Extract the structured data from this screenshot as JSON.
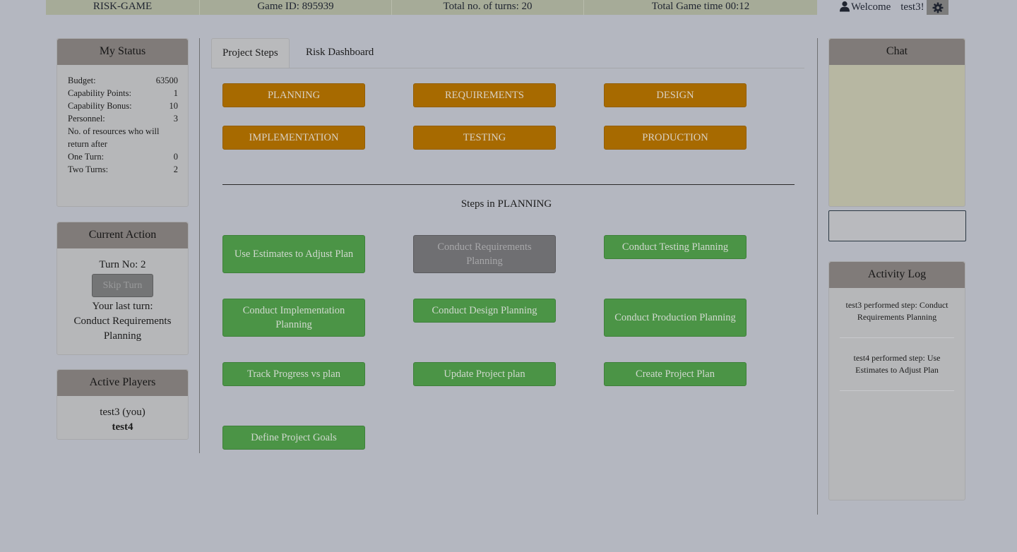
{
  "topbar": {
    "app_title": "RISK-GAME",
    "game_id": "Game  ID: 895939",
    "total_turns": "Total  no. of turns:  20",
    "total_time": "Total  Game  time  00:12"
  },
  "user": {
    "welcome": "Welcome",
    "username": "test3!"
  },
  "my_status": {
    "title": "My Status",
    "rows": [
      {
        "label": "Budget:",
        "value": "63500"
      },
      {
        "label": "Capability  Points:",
        "value": "1"
      },
      {
        "label": "Capability  Bonus:",
        "value": "10"
      },
      {
        "label": "Personnel:",
        "value": "3"
      }
    ],
    "resources_note": "No. of resources  who  will return  after",
    "return_rows": [
      {
        "label": "One Turn:",
        "value": "0"
      },
      {
        "label": "Two Turns:",
        "value": "2"
      }
    ]
  },
  "current_action": {
    "title": "Current  Action",
    "turn_no": "Turn  No: 2",
    "skip_label": "Skip Turn",
    "last_turn_label": "Your  last turn:",
    "last_turn_value": "Conduct  Requirements Planning"
  },
  "active_players": {
    "title": "Active Players",
    "players": [
      "test3  (you)",
      "test4"
    ]
  },
  "tabs": {
    "project_steps": "Project Steps",
    "risk_dashboard": "Risk Dashboard"
  },
  "phases": [
    "PLANNING",
    "REQUIREMENTS",
    "DESIGN",
    "IMPLEMENTATION",
    "TESTING",
    "PRODUCTION"
  ],
  "steps_title": "Steps  in  PLANNING",
  "steps": [
    "Use Estimates  to Adjust Plan",
    "Conduct  Requirements Planning",
    "Conduct  Testing  Planning",
    "Conduct  Implementation Planning",
    "Conduct  Design  Planning",
    "Conduct  Production Planning",
    "Track Progress  vs plan",
    "Update  Project  plan",
    "Create  Project  Plan",
    "Define  Project  Goals"
  ],
  "chat": {
    "title": "Chat",
    "input_value": ""
  },
  "activity_log": {
    "title": "Activity  Log",
    "entries": [
      "test3  performed   step:  Conduct Requirements   Planning",
      "test4  performed   step:  Use Estimates  to  Adjust  Plan"
    ]
  },
  "colors": {
    "topbar": "#a6ab98",
    "phase_button": "#a76a00",
    "step_button": "#4b9446",
    "disabled_button": "#6f6f72",
    "panel_header": "#807b79",
    "chat_background": "#b7b7a2"
  },
  "icons": {
    "user": "user-icon",
    "settings": "gear-icon"
  }
}
